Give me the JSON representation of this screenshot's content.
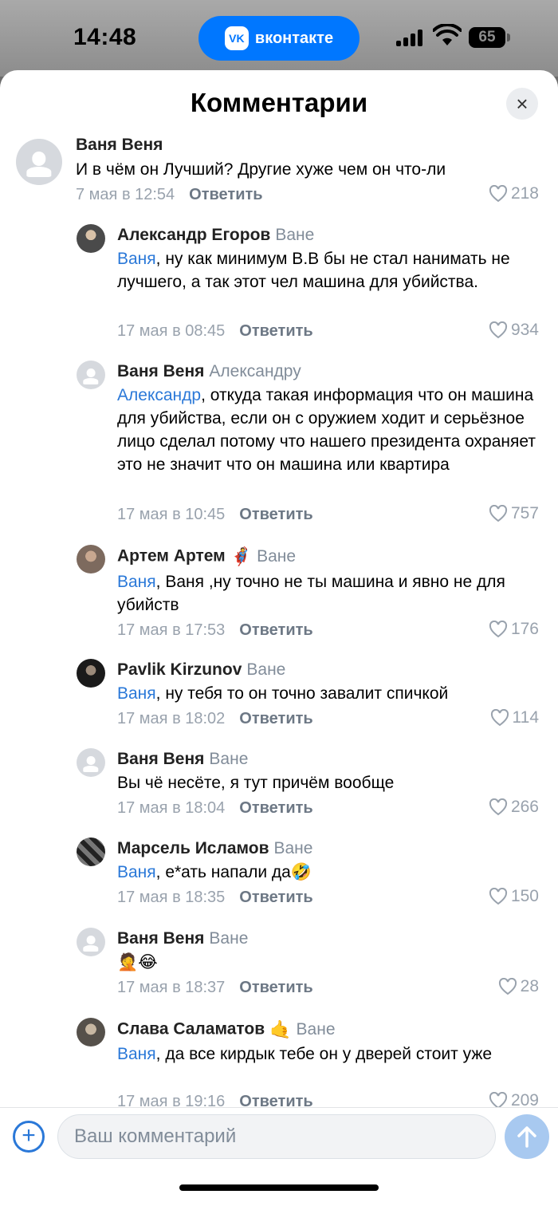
{
  "status_bar": {
    "time": "14:48",
    "app_pill": "вконтакте",
    "app_logo": "VK",
    "battery": "65"
  },
  "sheet": {
    "title": "Комментарии",
    "close_icon": "×"
  },
  "comments": [
    {
      "author": "Ваня Веня",
      "reply_to": "",
      "avatar": "default",
      "mention": "",
      "text": "И в чём он Лучший? Другие хуже чем он что-ли",
      "date": "7 мая в 12:54",
      "reply_label": "Ответить",
      "likes": "218"
    },
    {
      "author": "Александр Егоров",
      "reply_to": "Ване",
      "avatar": "photo",
      "mention": "Ваня",
      "text": ", ну как минимум В.В бы не стал нанимать не лучшего, а так этот чел машина для убийства.",
      "date": "17 мая в 08:45",
      "reply_label": "Ответить",
      "likes": "934"
    },
    {
      "author": "Ваня Веня",
      "reply_to": "Александру",
      "avatar": "default",
      "mention": "Александр",
      "text": ", откуда такая информация что он машина для убийства, если он с оружием ходит и серьёзное лицо сделал потому что нашего президента охраняет это не значит что он машина или квартира",
      "date": "17 мая в 10:45",
      "reply_label": "Ответить",
      "likes": "757"
    },
    {
      "author": "Артем Артем",
      "reply_to": "Ване",
      "avatar": "photo2",
      "badge": "🦸",
      "mention": "Ваня",
      "text": ", Ваня ,ну точно не ты машина и явно не для убийств",
      "date": "17 мая в 17:53",
      "reply_label": "Ответить",
      "likes": "176"
    },
    {
      "author": "Pavlik Kirzunov",
      "reply_to": "Ване",
      "avatar": "photo3",
      "mention": "Ваня",
      "text": ", ну тебя то он точно завалит спичкой",
      "date": "17 мая в 18:02",
      "reply_label": "Ответить",
      "likes": "114"
    },
    {
      "author": "Ваня Веня",
      "reply_to": "Ване",
      "avatar": "default",
      "mention": "",
      "text": "Вы чё несёте, я тут причём вообще",
      "date": "17 мая в 18:04",
      "reply_label": "Ответить",
      "likes": "266"
    },
    {
      "author": "Марсель Исламов",
      "reply_to": "Ване",
      "avatar": "photo4",
      "mention": "Ваня",
      "text": ", е*ать напали да🤣",
      "date": "17 мая в 18:35",
      "reply_label": "Ответить",
      "likes": "150"
    },
    {
      "author": "Ваня Веня",
      "reply_to": "Ване",
      "avatar": "default",
      "mention": "",
      "text": "🤦😂",
      "date": "17 мая в 18:37",
      "reply_label": "Ответить",
      "likes": "28"
    },
    {
      "author": "Слава Саламатов",
      "reply_to": "Ване",
      "avatar": "photo5",
      "badge": "🤙",
      "mention": "Ваня",
      "text": ", да все кирдык тебе он у дверей стоит уже",
      "date": "17 мая в 19:16",
      "reply_label": "Ответить",
      "likes": "209"
    }
  ],
  "composer": {
    "plus_icon": "+",
    "placeholder": "Ваш комментарий"
  },
  "colors": {
    "accent": "#0077ff",
    "mention": "#2a78d8",
    "meta": "#99a2ad"
  }
}
